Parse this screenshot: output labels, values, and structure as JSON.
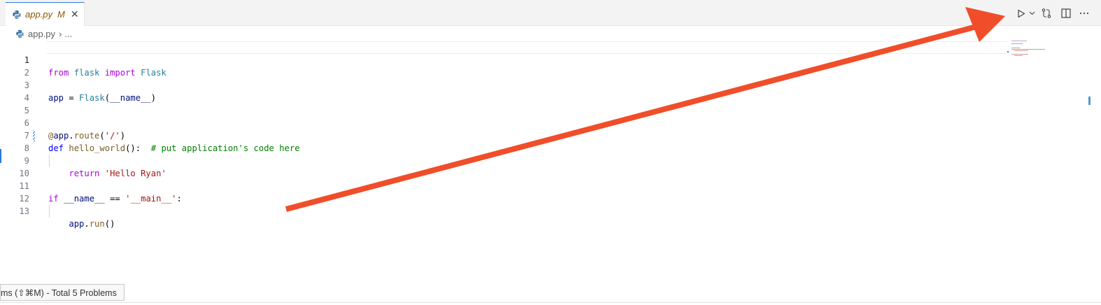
{
  "tab": {
    "filename": "app.py",
    "status": "M"
  },
  "breadcrumb": {
    "file": "app.py",
    "more": "..."
  },
  "editor": {
    "line_numbers": [
      "1",
      "2",
      "3",
      "4",
      "5",
      "6",
      "7",
      "8",
      "9",
      "10",
      "11",
      "12",
      "13"
    ]
  },
  "status": {
    "problems_text": "ms (⇧⌘M) - Total 5 Problems"
  },
  "icons": {
    "run": "play-icon",
    "run_menu": "chevron-down-icon",
    "source_control": "git-compare-icon",
    "split": "split-editor-icon",
    "more": "more-actions-icon",
    "tab_close": "close-icon",
    "file": "python-file-icon"
  },
  "colors": {
    "annotation_arrow": "#f04e2a",
    "accent": "#2b7bd3",
    "tab_modified_text": "#8a5a00"
  }
}
